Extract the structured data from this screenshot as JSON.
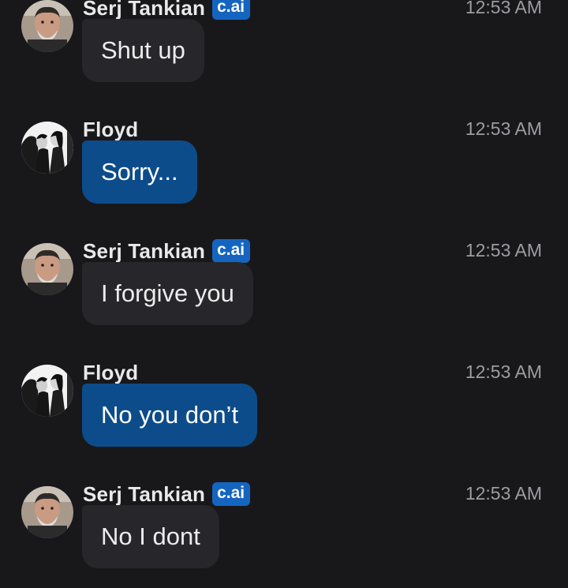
{
  "messages": [
    {
      "sender": "Serj Tankian",
      "badge": "c.ai",
      "time": "12:53 AM",
      "text": "Shut up",
      "kind": "bot"
    },
    {
      "sender": "Floyd",
      "badge": "",
      "time": "12:53 AM",
      "text": "Sorry...",
      "kind": "user"
    },
    {
      "sender": "Serj Tankian",
      "badge": "c.ai",
      "time": "12:53 AM",
      "text": "I forgive you",
      "kind": "bot"
    },
    {
      "sender": "Floyd",
      "badge": "",
      "time": "12:53 AM",
      "text": "No you don’t",
      "kind": "user"
    },
    {
      "sender": "Serj Tankian",
      "badge": "c.ai",
      "time": "12:53 AM",
      "text": "No I dont",
      "kind": "bot"
    }
  ],
  "colors": {
    "background": "#18181b",
    "bot_bubble": "#27272b",
    "user_bubble": "#0d4c8a",
    "badge": "#1565c0",
    "timestamp": "#9c9ca3"
  },
  "icons": {
    "bot_avatar": "serj-avatar-icon",
    "user_avatar": "floyd-avatar-icon"
  }
}
